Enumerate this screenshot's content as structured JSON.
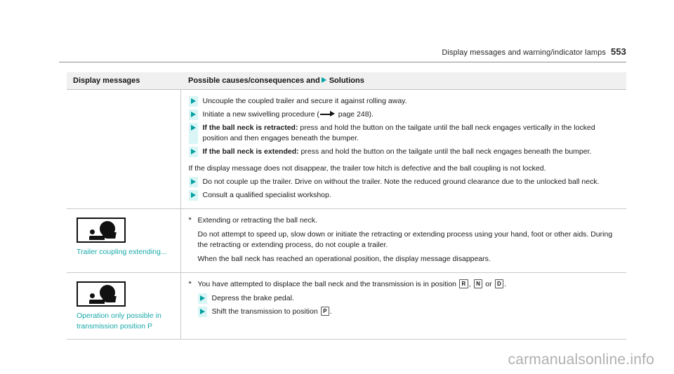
{
  "header": {
    "title": "Display messages and warning/indicator lamps",
    "page_number": "553"
  },
  "table": {
    "columns": {
      "left": "Display messages",
      "right_prefix": "Possible causes/consequences and",
      "right_suffix": "Solutions"
    },
    "rows": [
      {
        "left": {
          "symbol": null,
          "label": null
        },
        "right": {
          "steps_group_1": [
            {
              "text": "Uncouple the coupled trailer and secure it against rolling away."
            },
            {
              "text_before": "Initiate a new swivelling procedure (",
              "arrow": "right-arrow",
              "text_after": " page 248)."
            },
            {
              "bold": "If the ball neck is retracted:",
              "text": " press and hold the button on the tailgate until the ball neck engages vertically in the locked position and then engages beneath the bumper."
            },
            {
              "bold": "If the ball neck is extended:",
              "text": " press and hold the button on the tailgate until the ball neck engages beneath the bumper."
            }
          ],
          "paragraph": "If the display message does not disappear, the trailer tow hitch is defective and the ball coupling is not locked.",
          "steps_group_2": [
            {
              "text": "Do not couple up the trailer. Drive on without the trailer. Note the reduced ground clearance due to the unlocked ball neck."
            },
            {
              "text": "Consult a qualified specialist workshop."
            }
          ]
        }
      },
      {
        "left": {
          "symbol": "trailer-coupling-symbol",
          "label": "Trailer coupling extending..."
        },
        "right": {
          "star_line": "Extending or retracting the ball neck.",
          "paragraphs": [
            "Do not attempt to speed up, slow down or initiate the retracting or extending process using your hand, foot or other aids. During the retracting or extending process, do not couple a trailer.",
            "When the ball neck has reached an operational position, the display message disappears."
          ]
        }
      },
      {
        "left": {
          "symbol": "trailer-coupling-symbol",
          "label": "Operation only possible in transmission position P"
        },
        "right": {
          "star_line_parts": {
            "before": "You have attempted to displace the ball neck and the transmission is in position ",
            "gear_1": "R",
            "sep_1": ", ",
            "gear_2": "N",
            "sep_2": " or ",
            "gear_3": "D",
            "after": "."
          },
          "steps": [
            {
              "text": "Depress the brake pedal."
            },
            {
              "text_before": "Shift the transmission to position ",
              "gear": "P",
              "text_after": "."
            }
          ]
        }
      }
    ]
  },
  "watermark": "carmanualsonline.info",
  "colors": {
    "accent_teal": "#19a8a8",
    "bullet_teal": "#00a0a0",
    "bullet_bg": "#d9f5f5",
    "header_bg": "#f0f0f0",
    "border": "#c9c9c9",
    "watermark": "#b0b0b0"
  }
}
